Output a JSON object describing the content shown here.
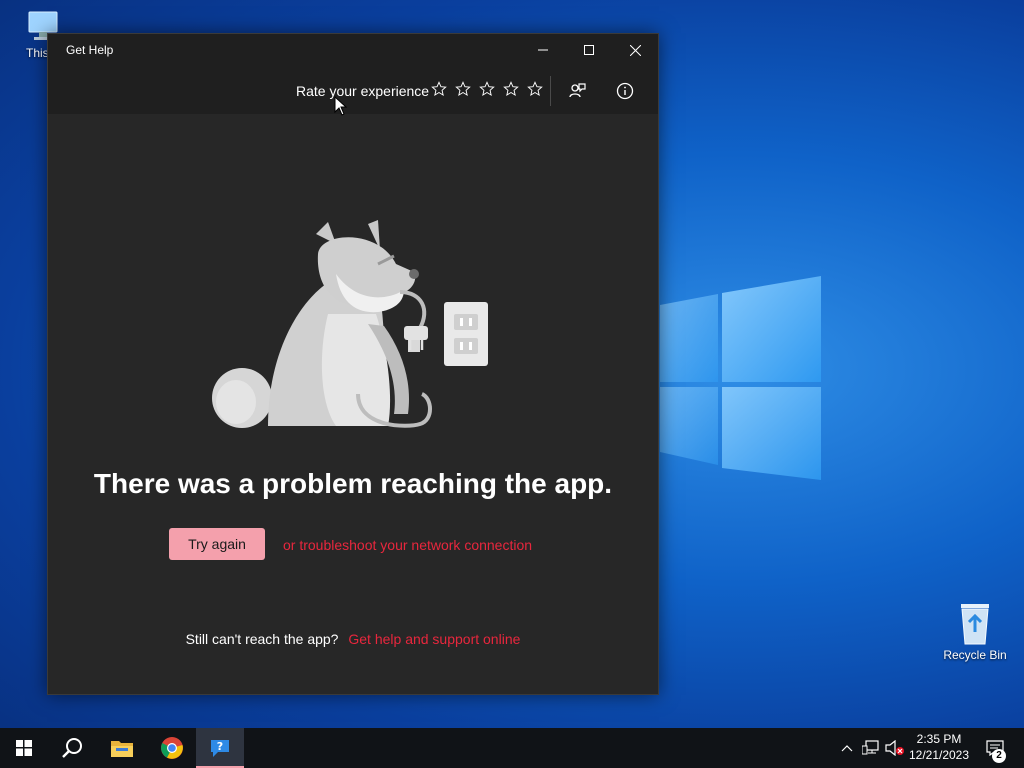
{
  "desktop": {
    "icons": [
      {
        "label": "This P",
        "icon": "this-pc-icon"
      },
      {
        "label": "Recycle Bin",
        "icon": "recycle-bin-icon"
      }
    ]
  },
  "window": {
    "title": "Get Help",
    "controls": {
      "minimize": "minimize-icon",
      "maximize": "maximize-icon",
      "close": "close-icon"
    },
    "toolbar": {
      "rate_label": "Rate your experience",
      "stars_total": 5,
      "stars_selected": 0,
      "feedback_icon": "feedback-icon",
      "info_icon": "info-icon"
    },
    "content": {
      "headline": "There was a problem reaching the app.",
      "try_again": "Try again",
      "troubleshoot_link": "or troubleshoot your network connection",
      "still_text": "Still can't reach the app?",
      "support_link": "Get help and support online"
    }
  },
  "taskbar": {
    "pinned": [
      "start-icon",
      "search-icon",
      "file-explorer-icon",
      "chrome-icon",
      "get-help-icon"
    ],
    "active": "get-help-icon",
    "tray": {
      "chevron": "show-hidden-icons-icon",
      "network": "network-icon",
      "volume": "volume-muted-icon"
    },
    "time": "2:35 PM",
    "date": "12/21/2023",
    "notifications_count": "2"
  },
  "colors": {
    "accent_pink": "#f4a0ac",
    "link_red": "#e8273d",
    "window_bg": "#272727",
    "titlebar_bg": "#1f1f1f"
  }
}
